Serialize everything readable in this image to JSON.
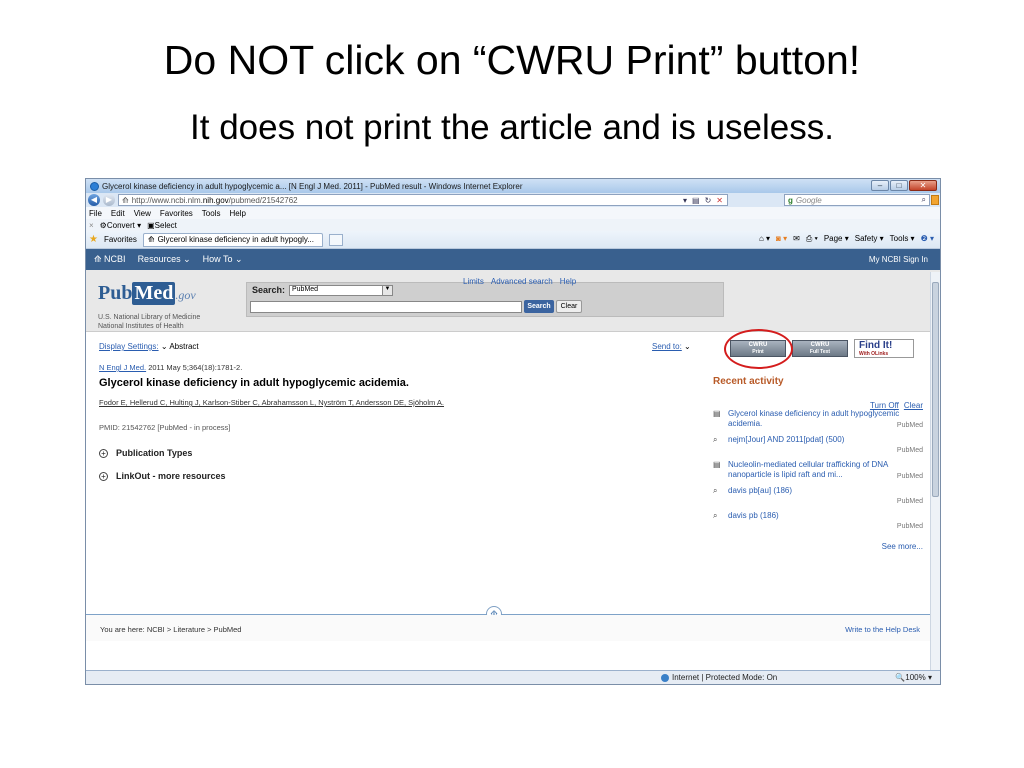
{
  "slide": {
    "title": "Do NOT click on “CWRU Print” button!",
    "subtitle": "It does not print the article and is useless."
  },
  "browser": {
    "window_title": "Glycerol kinase deficiency in adult hypoglycemic a... [N Engl J Med. 2011] - PubMed result - Windows Internet Explorer",
    "address_prefix": "http://www.ncbi.nlm.",
    "address_domain": "nih.gov",
    "address_path": "/pubmed/21542762",
    "search_placeholder": "Google",
    "menu": [
      "File",
      "Edit",
      "View",
      "Favorites",
      "Tools",
      "Help"
    ],
    "convert_label": "Convert",
    "select_label": "Select",
    "favorites_label": "Favorites",
    "tab_title": "Glycerol kinase deficiency in adult hypogly...",
    "cmd": [
      "Page ▾",
      "Safety ▾",
      "Tools ▾"
    ],
    "status_zone": "Internet | Protected Mode: On",
    "zoom": "100%"
  },
  "ncbi": {
    "brand": "NCBI",
    "resources": "Resources",
    "howto": "How To",
    "right": "My NCBI  Sign In"
  },
  "pubmed": {
    "logo_pub": "Pub",
    "logo_med": "Med",
    "logo_gov": ".gov",
    "lib1": "U.S. National Library of Medicine",
    "lib2": "National Institutes of Health",
    "search_label": "Search:",
    "search_db": "PubMed",
    "links": [
      "Limits",
      "Advanced search",
      "Help"
    ],
    "search_btn": "Search",
    "clear_btn": "Clear"
  },
  "article": {
    "display_settings": "Display Settings:",
    "display_mode": "Abstract",
    "send_to": "Send to:",
    "journal": "N Engl J Med.",
    "citation": "2011 May 5;364(18):1781-2.",
    "title": "Glycerol kinase deficiency in adult hypoglycemic acidemia.",
    "authors": "Fodor E, Hellerud C, Hulting J, Karlson-Stiber C, Abrahamsson L, Nyström T, Andersson DE, Sjöholm A.",
    "pmid": "PMID: 21542762 [PubMed - in process]",
    "sections": [
      "Publication Types",
      "LinkOut - more resources"
    ]
  },
  "fulltext": {
    "cwru_print_top": "CWRU",
    "cwru_print_bottom": "Print",
    "cwru_full_top": "CWRU",
    "cwru_full_bottom": "Full Text",
    "findit": "Find It!",
    "findit_sub": "With OLinks"
  },
  "recent": {
    "heading": "Recent activity",
    "turn_off": "Turn Off",
    "clear": "Clear",
    "items": [
      {
        "text": "Glycerol kinase deficiency in adult hypoglycemic acidemia.",
        "source": "PubMed",
        "icon": "document-icon"
      },
      {
        "text": "nejm[Jour] AND 2011[pdat] (500)",
        "source": "PubMed",
        "icon": "search-icon"
      },
      {
        "text": "Nucleolin-mediated cellular trafficking of DNA nanoparticle is lipid raft and mi...",
        "source": "PubMed",
        "icon": "document-icon"
      },
      {
        "text": "davis pb[au] (186)",
        "source": "PubMed",
        "icon": "search-icon"
      },
      {
        "text": "davis pb (186)",
        "source": "PubMed",
        "icon": "search-icon"
      }
    ],
    "see_more": "See more..."
  },
  "footer": {
    "breadcrumb": "You are here: NCBI > Literature > PubMed",
    "help": "Write to the Help Desk"
  }
}
